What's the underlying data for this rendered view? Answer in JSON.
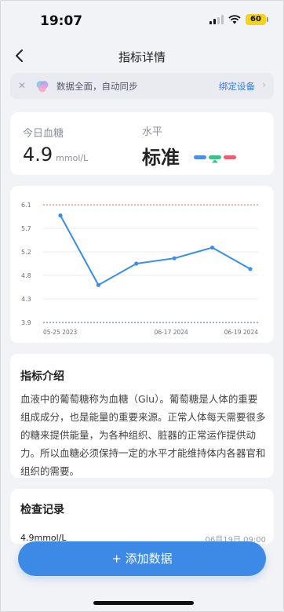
{
  "status_bar": {
    "time": "19:07",
    "battery": "60"
  },
  "nav": {
    "title": "指标详情"
  },
  "banner": {
    "text": "数据全面，自动同步",
    "action": "绑定设备"
  },
  "today": {
    "label": "今日血糖",
    "value": "4.9",
    "unit": "mmol/L",
    "level_label": "水平",
    "level_value": "标准"
  },
  "chart_data": {
    "type": "line",
    "x": [
      "05-25 2023",
      "",
      "",
      "06-17 2024",
      "",
      "06-19 2024"
    ],
    "y_ticks": [
      "6.1",
      "5.7",
      "5.2",
      "4.8",
      "4.3",
      "3.9"
    ],
    "values": [
      5.9,
      4.6,
      5.0,
      5.1,
      5.3,
      4.9
    ],
    "upper_limit": 6.1,
    "lower_limit": 3.9,
    "x_tick_labels": [
      "05-25 2023",
      "06-17 2024",
      "06-19 2024"
    ],
    "colors": {
      "line": "#3a8ee6",
      "upper": "#e0624a",
      "lower": "#3a5fb0"
    }
  },
  "intro": {
    "title": "指标介绍",
    "body": "血液中的葡萄糖称为血糖（Glu）。葡萄糖是人体的重要组成成分，也是能量的重要来源。正常人体每天需要很多的糖来提供能量，为各种组织、脏器的正常运作提供动力。所以血糖必须保持一定的水平才能维持体内各器官和组织的需要。"
  },
  "records": {
    "title": "检查记录",
    "first_value": "4.9mmol/L",
    "first_time": "06月19日 09:00"
  },
  "add_button": "+ 添加数据"
}
